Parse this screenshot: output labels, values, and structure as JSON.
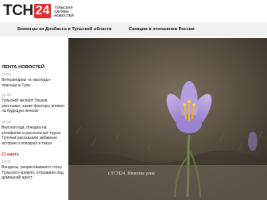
{
  "header": {
    "logo_main": "ТСН",
    "logo_number": "24",
    "logo_subtitle": "Тульская служба новостей"
  },
  "nav": {
    "items": [
      {
        "label": "Беженцы из Донбасса в Тульской области"
      },
      {
        "label": "Санкции в отношении России"
      }
    ]
  },
  "sidebar": {
    "title": "Лента новостей",
    "items": [
      {
        "time": "13:02",
        "text": "Ветеринарны «к лисоеды» опасные в Туле"
      },
      {
        "time": "01:29",
        "text": "Тульский эксперт Трунов рассказал, какие факторы влияют на будущую пенсию"
      },
      {
        "time": "00:18",
        "text": "Вкусная еда, поездка на катафалке и рассыльные трусы: Тулячки рассказали забавные истории о поездках в такси"
      }
    ],
    "date_label": "21 марта",
    "items_after_date": [
      {
        "time": "23:05",
        "text": "Вандалы, разрисовавшего стену Тульского кремля, отправили под домашний арест"
      }
    ]
  },
  "main_image": {
    "caption": "г.ТСН24.   Иванова улик"
  },
  "colors": {
    "brand_red": "#e8282b",
    "nav_bg": "#f0f0f0",
    "date_red": "#e8282b"
  }
}
